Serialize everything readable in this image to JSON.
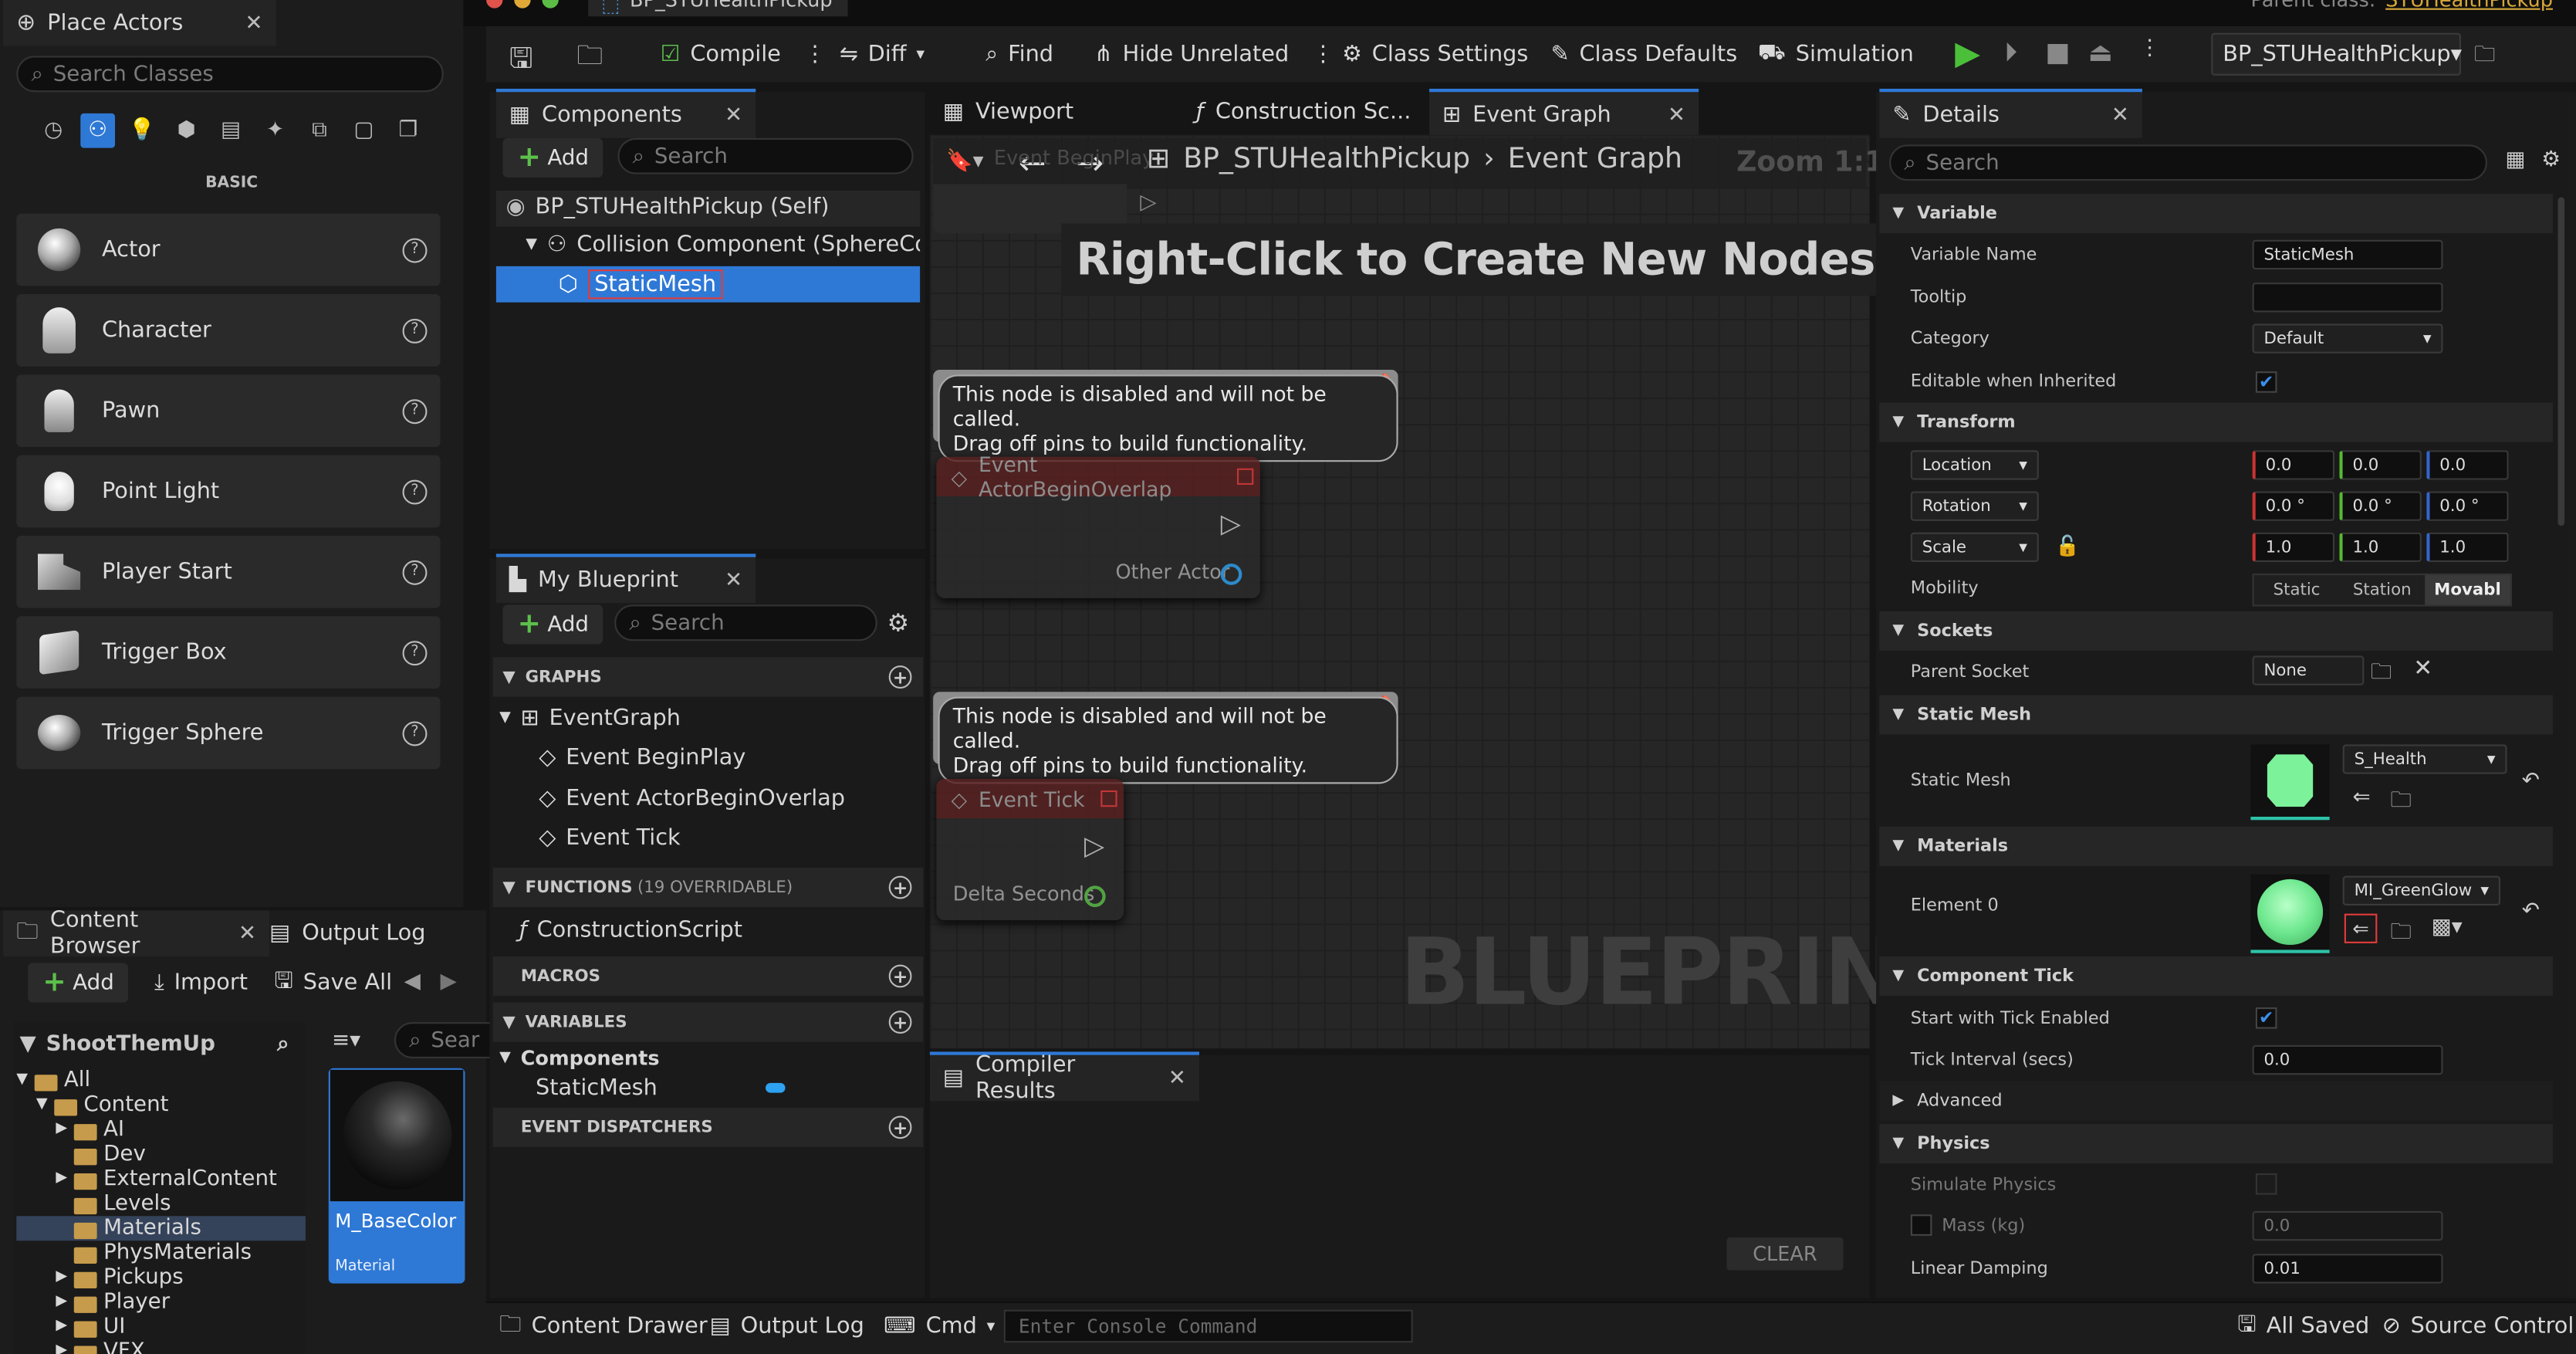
{
  "colors": {
    "accent": "#2f79d6",
    "selection": "#2f79d6",
    "green": "#4bbf3a"
  },
  "place_actors": {
    "tab_title": "Place Actors",
    "search_placeholder": "Search Classes",
    "category": "BASIC",
    "items": [
      {
        "label": "Actor",
        "icon": "sphere-icon"
      },
      {
        "label": "Character",
        "icon": "character-icon"
      },
      {
        "label": "Pawn",
        "icon": "pawn-icon"
      },
      {
        "label": "Point Light",
        "icon": "lightbulb-icon"
      },
      {
        "label": "Player Start",
        "icon": "player-start-icon"
      },
      {
        "label": "Trigger Box",
        "icon": "cube-icon"
      },
      {
        "label": "Trigger Sphere",
        "icon": "sphere-icon"
      }
    ]
  },
  "content_browser": {
    "tab_title": "Content Browser",
    "output_log_tab": "Output Log",
    "add_label": "Add",
    "import_label": "Import",
    "save_all_label": "Save All",
    "project_name": "ShootThemUp",
    "search_placeholder": "Sear",
    "tree": [
      "All",
      "Content",
      "AI",
      "Dev",
      "ExternalContent",
      "Levels",
      "Materials",
      "PhysMaterials",
      "Pickups",
      "Player",
      "UI",
      "VFX"
    ],
    "asset": {
      "name": "M_BaseColor",
      "type": "Material"
    }
  },
  "window": {
    "tab_title": "BP_STUHealthPickup",
    "parent_class_label": "Parent class:",
    "parent_class": "STUHealthPickup"
  },
  "toolbar": {
    "compile": "Compile",
    "diff": "Diff",
    "find": "Find",
    "hide_unrelated": "Hide Unrelated",
    "class_settings": "Class Settings",
    "class_defaults": "Class Defaults",
    "simulation": "Simulation",
    "debug_object": "BP_STUHealthPickup"
  },
  "components": {
    "tab_title": "Components",
    "add_label": "Add",
    "search_placeholder": "Search",
    "items": [
      "BP_STUHealthPickup (Self)",
      "Collision Component (SphereCompon",
      "StaticMesh"
    ]
  },
  "my_blueprint": {
    "tab_title": "My Blueprint",
    "add_label": "Add",
    "search_placeholder": "Search",
    "graphs_header": "GRAPHS",
    "graphs": [
      "EventGraph",
      "Event BeginPlay",
      "Event ActorBeginOverlap",
      "Event Tick"
    ],
    "functions_header": "FUNCTIONS",
    "functions_count": "(19 OVERRIDABLE)",
    "functions": [
      "ConstructionScript"
    ],
    "macros_header": "MACROS",
    "variables_header": "VARIABLES",
    "variable_category": "Components",
    "variables": [
      "StaticMesh"
    ],
    "dispatchers_header": "EVENT DISPATCHERS"
  },
  "graph": {
    "tabs": [
      "Viewport",
      "Construction Sc...",
      "Event Graph"
    ],
    "breadcrumb_root": "BP_STUHealthPickup",
    "breadcrumb_leaf": "Event Graph",
    "zoom": "Zoom 1:1",
    "hint": "Right-Click to Create New Nodes.",
    "watermark": "BLUEPRINT",
    "ghost_node_title": "Event BeginPlay",
    "comment_text": "This node is disabled and will not be called.\nDrag off pins to build functionality.",
    "node1_title": "Event ActorBeginOverlap",
    "node1_pin": "Other Actor",
    "node2_title": "Event Tick",
    "node2_pin": "Delta Seconds"
  },
  "compiler_results": {
    "tab_title": "Compiler Results",
    "clear_label": "CLEAR"
  },
  "details": {
    "tab_title": "Details",
    "search_placeholder": "Search",
    "sections": {
      "variable": "Variable",
      "transform": "Transform",
      "sockets": "Sockets",
      "static_mesh": "Static Mesh",
      "materials": "Materials",
      "component_tick": "Component Tick",
      "advanced": "Advanced",
      "physics": "Physics"
    },
    "variable_name_label": "Variable Name",
    "variable_name_value": "StaticMesh",
    "tooltip_label": "Tooltip",
    "tooltip_value": "",
    "category_label": "Category",
    "category_value": "Default",
    "editable_label": "Editable when Inherited",
    "location_label": "Location",
    "location": [
      "0.0",
      "0.0",
      "0.0"
    ],
    "rotation_label": "Rotation",
    "rotation": [
      "0.0 °",
      "0.0 °",
      "0.0 °"
    ],
    "scale_label": "Scale",
    "scale": [
      "1.0",
      "1.0",
      "1.0"
    ],
    "mobility_label": "Mobility",
    "mobility_options": [
      "Static",
      "Station",
      "Movabl"
    ],
    "parent_socket_label": "Parent Socket",
    "parent_socket_value": "None",
    "static_mesh_label": "Static Mesh",
    "static_mesh_value": "S_Health",
    "element0_label": "Element 0",
    "element0_value": "MI_GreenGlow",
    "start_tick_label": "Start with Tick Enabled",
    "tick_interval_label": "Tick Interval (secs)",
    "tick_interval_value": "0.0",
    "simulate_physics_label": "Simulate Physics",
    "mass_label": "Mass (kg)",
    "mass_value": "0.0",
    "linear_damping_label": "Linear Damping",
    "linear_damping_value": "0.01"
  },
  "status_bar": {
    "content_drawer": "Content Drawer",
    "output_log": "Output Log",
    "cmd": "Cmd",
    "console_placeholder": "Enter Console Command",
    "all_saved": "All Saved",
    "source_control": "Source Control"
  }
}
